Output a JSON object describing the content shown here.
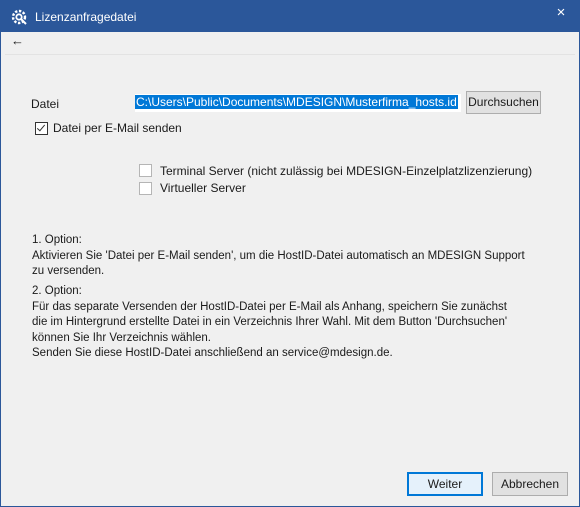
{
  "window": {
    "title": "Lizenzanfragedatei",
    "close_glyph": "×",
    "titlebar_color": "#2b579a"
  },
  "toolbar": {
    "back_glyph": "←"
  },
  "form": {
    "file_label": "Datei",
    "file_path": "C:\\Users\\Public\\Documents\\MDESIGN\\Musterfirma_hosts.id",
    "browse_label": "Durchsuchen",
    "email_label": "Datei per E-Mail senden",
    "email_checked": true,
    "terminal_label": "Terminal Server (nicht zulässig bei MDESIGN-Einzelplatzlizenzierung)",
    "terminal_checked": false,
    "virtual_label": "Virtueller Server",
    "virtual_checked": false
  },
  "info": {
    "option1_title": "1. Option:",
    "option1_text": "Aktivieren Sie 'Datei per E-Mail senden', um die HostID-Datei automatisch an MDESIGN Support zu versenden.",
    "option2_title": "2. Option:",
    "option2_text": "Für das separate Versenden der HostID-Datei per E-Mail als Anhang, speichern Sie zunächst die im Hintergrund erstellte Datei in ein Verzeichnis Ihrer Wahl. Mit dem Button 'Durchsuchen' können Sie Ihr Verzeichnis wählen.",
    "option2_text2": "Senden Sie diese HostID-Datei anschließend an service@mdesign.de."
  },
  "footer": {
    "next_label": "Weiter",
    "cancel_label": "Abbrechen"
  },
  "icons": {
    "app": "gear-icon",
    "close": "close-icon",
    "back": "arrow-left-icon"
  }
}
